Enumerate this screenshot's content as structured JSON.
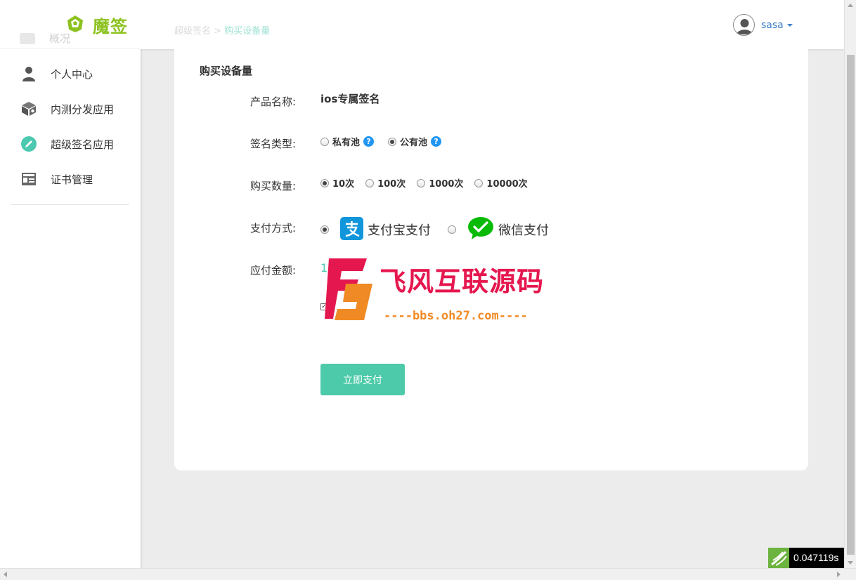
{
  "app": {
    "name": "魔签",
    "brand_color": "#8cc21f",
    "accent_color": "#4cc9b0"
  },
  "sidebar": {
    "ghost_item": "概况",
    "items": [
      {
        "label": "个人中心",
        "icon": "user-icon"
      },
      {
        "label": "内测分发应用",
        "icon": "package-icon"
      },
      {
        "label": "超级签名应用",
        "icon": "pen-icon"
      },
      {
        "label": "证书管理",
        "icon": "certificate-icon"
      }
    ]
  },
  "header": {
    "breadcrumb": {
      "parent": "超级签名",
      "separator": ">",
      "current": "购买设备量"
    },
    "user": {
      "name": "sasa"
    }
  },
  "card": {
    "title": "购买设备量",
    "fields": {
      "product_label": "产品名称:",
      "product_value": "ios专属签名",
      "sign_type_label": "签名类型:",
      "sign_types": [
        {
          "label": "私有池",
          "checked": false
        },
        {
          "label": "公有池",
          "checked": true
        }
      ],
      "help_glyph": "?",
      "quantity_label": "购买数量:",
      "quantities": [
        {
          "label": "10次",
          "checked": true
        },
        {
          "label": "100次",
          "checked": false
        },
        {
          "label": "1000次",
          "checked": false
        },
        {
          "label": "10000次",
          "checked": false
        }
      ],
      "payment_label": "支付方式:",
      "payments": [
        {
          "label": "支付宝支付",
          "checked": true,
          "icon": "alipay-icon",
          "color": "#1296db"
        },
        {
          "label": "微信支付",
          "checked": false,
          "icon": "wechat-icon",
          "color": "#09bb07"
        }
      ],
      "amount_label": "应付金额:",
      "amount_value": "1",
      "agree_checked": true
    },
    "pay_button": "立即支付"
  },
  "watermark": {
    "text": "飞风互联源码",
    "url": "----bbs.oh27.com----",
    "logo": "F"
  },
  "timer": {
    "value": "0.047119s"
  }
}
